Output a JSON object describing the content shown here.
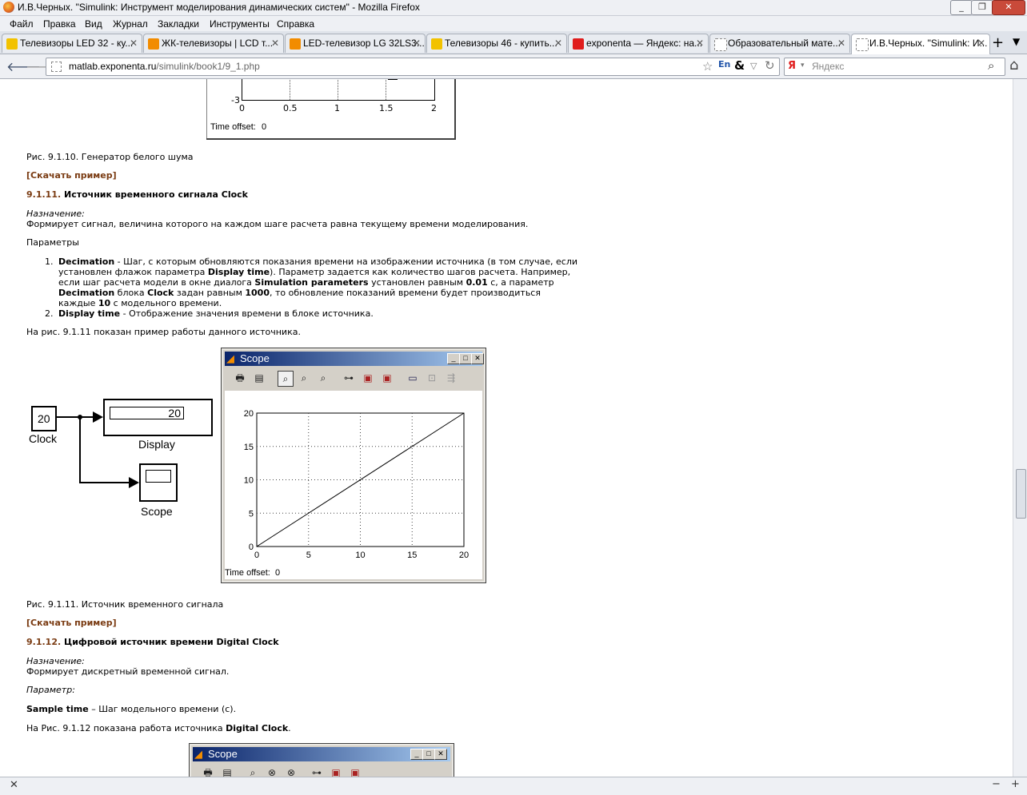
{
  "window": {
    "title": "И.В.Черных. \"Simulink: Инструмент моделирования динамических систем\" - Mozilla Firefox"
  },
  "menu": [
    "Файл",
    "Правка",
    "Вид",
    "Журнал",
    "Закладки",
    "Инструменты",
    "Справка"
  ],
  "tabs": [
    {
      "label": "Телевизоры LED 32 - ку...",
      "icon_color": "#f2c200"
    },
    {
      "label": "ЖК-телевизоры | LCD т...",
      "icon_color": "#f28c00"
    },
    {
      "label": "LED-телевизор LG 32LS3...",
      "icon_color": "#f28c00"
    },
    {
      "label": "Телевизоры 46 - купить...",
      "icon_color": "#f2c200"
    },
    {
      "label": "exponenta — Яндекс: на...",
      "icon_color": "#e01d1d"
    },
    {
      "label": "Образовательный мате...",
      "icon_color": "#cccccc"
    },
    {
      "label": "И.В.Черных. \"Simulink: И...",
      "icon_color": "#cccccc"
    }
  ],
  "nav": {
    "url_domain": "matlab.exponenta.ru",
    "url_path": "/simulink/book1/9_1.php",
    "search_placeholder": "Яндекс",
    "lang": "En"
  },
  "top_scope": {
    "y_tick": "-3",
    "x_ticks": [
      "0",
      "0.5",
      "1",
      "1.5",
      "2"
    ],
    "time_offset_label": "Time offset:",
    "time_offset_value": "0"
  },
  "content": {
    "fig10_caption": "Рис. 9.1.10. Генератор белого шума",
    "download1": "[Скачать пример]",
    "s11_num": "9.1.11.",
    "s11_title": " Источник временного сигнала Clock",
    "purpose_label": "Назначение:",
    "s11_purpose": "Формирует сигнал, величина которого на каждом шаге расчета равна текущему времени моделирования.",
    "params_label": "Параметры",
    "item1_l1_b": "Decimation",
    "item1_l1": " - Шаг, с которым обновляются показания времени на изображении источника (в том случае, если",
    "item1_l2a": "установлен флажок параметра ",
    "item1_l2b": "Display time",
    "item1_l2c": "). Параметр задается как количество шагов расчета. Например,",
    "item1_l3a": "если шаг расчета модели в окне диалога ",
    "item1_l3b": "Simulation parameters",
    "item1_l3c": " установлен равным ",
    "item1_l3d": "0.01",
    "item1_l3e": " с, а параметр",
    "item1_l4a": "Decimation",
    "item1_l4b": " блока ",
    "item1_l4c": "Clock",
    "item1_l4d": " задан равным ",
    "item1_l4e": "1000",
    "item1_l4f": ", то обновление показаний времени будет производиться",
    "item1_l5a": "каждые ",
    "item1_l5b": "10",
    "item1_l5c": " с модельного времени.",
    "item2_b": "Display time",
    "item2": " - Отображение значения времени в блоке источника.",
    "fig11_intro": "На рис. 9.1.11 показан пример работы данного источника.",
    "fig11_caption": "Рис. 9.1.11. Источник временного сигнала",
    "download2": "[Скачать пример]",
    "s12_num": "9.1.12.",
    "s12_title": " Цифровой источник времени Digital Clock",
    "s12_purpose": "Формирует дискретный временной сигнал.",
    "param_label": "Параметр:",
    "sample_b": "Sample time",
    "sample": " – Шаг модельного времени (с).",
    "fig12_intro_a": "На Рис. 9.1.12 показана работа источника ",
    "fig12_intro_b": "Digital Clock",
    "fig12_intro_c": "."
  },
  "model": {
    "clock_value": "20",
    "clock_label": "Clock",
    "display_value": "20",
    "display_label": "Display",
    "scope_label": "Scope"
  },
  "scope_window": {
    "title": "Scope",
    "time_offset_label": "Time offset:",
    "time_offset_value": "0"
  },
  "scope_window2": {
    "title": "Scope"
  },
  "chart_data": {
    "type": "line",
    "x": [
      0,
      20
    ],
    "series": [
      {
        "values": [
          0,
          20
        ]
      }
    ],
    "x_ticks": [
      "0",
      "5",
      "10",
      "15",
      "20"
    ],
    "y_ticks": [
      "0",
      "5",
      "10",
      "15",
      "20"
    ],
    "xlim": [
      0,
      20
    ],
    "ylim": [
      0,
      20
    ],
    "grid": true,
    "line_color": "#000000"
  }
}
